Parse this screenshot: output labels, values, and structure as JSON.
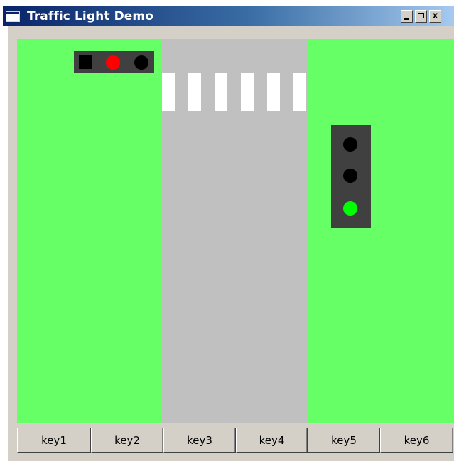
{
  "window": {
    "title": "Traffic Light Demo",
    "controls": {
      "minimize_icon": "minimize-icon",
      "maximize_icon": "maximize-icon",
      "close_icon": "close-icon",
      "close_glyph": "x"
    }
  },
  "scene": {
    "colors": {
      "grass": "#66ff66",
      "road": "#c0c0c0",
      "crosswalk": "#ffffff",
      "signal_housing": "#404040",
      "lamp_off": "#000000",
      "lamp_red": "#ff0000",
      "lamp_green": "#00ff00"
    },
    "pedestrian_signal": {
      "orientation": "horizontal",
      "lamps": [
        {
          "shape": "square",
          "state": "off",
          "color": "#000000"
        },
        {
          "shape": "circle",
          "state": "red",
          "color": "#ff0000"
        },
        {
          "shape": "circle",
          "state": "off",
          "color": "#000000"
        }
      ]
    },
    "vehicle_signal": {
      "orientation": "vertical",
      "lamps": [
        {
          "shape": "circle",
          "state": "off",
          "color": "#000000"
        },
        {
          "shape": "circle",
          "state": "off",
          "color": "#000000"
        },
        {
          "shape": "circle",
          "state": "green",
          "color": "#00ff00"
        }
      ]
    },
    "crosswalk_stripe_count": 6
  },
  "buttons": [
    {
      "label": "key1"
    },
    {
      "label": "key2"
    },
    {
      "label": "key3"
    },
    {
      "label": "key4"
    },
    {
      "label": "key5"
    },
    {
      "label": "key6"
    }
  ]
}
